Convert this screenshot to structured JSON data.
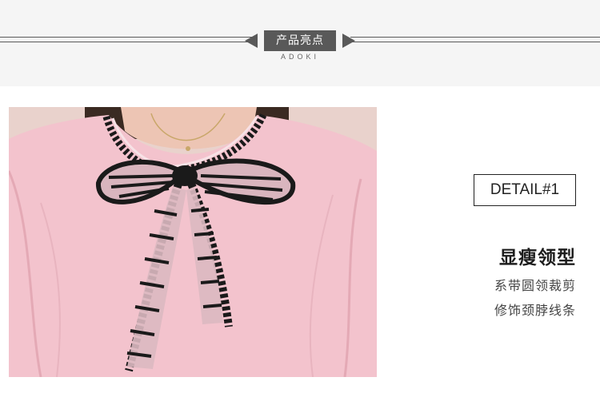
{
  "header": {
    "badge_label": "产品亮点",
    "sub_brand": "ADOKI",
    "line_color": "#5a5a5a",
    "badge_color": "#595959"
  },
  "photo": {
    "description_icon": "product-photo-pink-blouse-with-black-striped-bow"
  },
  "detail": {
    "tag": "DETAIL#1",
    "title": "显瘦领型",
    "lines": [
      "系带圆领裁剪",
      "修饰颈脖线条"
    ]
  }
}
